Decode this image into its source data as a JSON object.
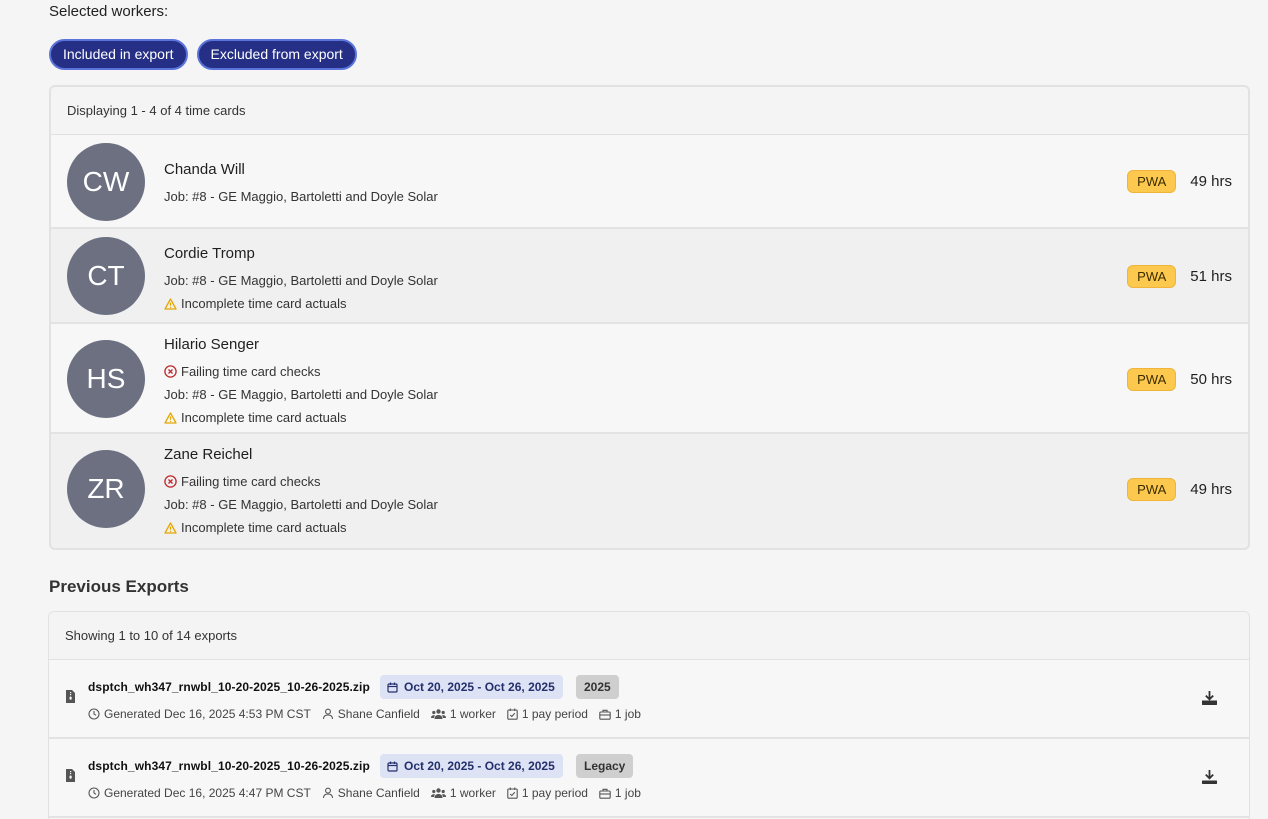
{
  "selected": {
    "title": "Selected workers:",
    "included_label": "Included in export",
    "excluded_label": "Excluded from export"
  },
  "timecards": {
    "summary": "Displaying 1 - 4 of 4 time cards",
    "workers": [
      {
        "initials": "CW",
        "name": "Chanda Will",
        "job": "Job: #8 - GE Maggio, Bartoletti and Doyle Solar",
        "failing": "",
        "incomplete": "",
        "badge": "PWA",
        "hours": "49 hrs"
      },
      {
        "initials": "CT",
        "name": "Cordie Tromp",
        "job": "Job: #8 - GE Maggio, Bartoletti and Doyle Solar",
        "failing": "",
        "incomplete": "Incomplete time card actuals",
        "badge": "PWA",
        "hours": "51 hrs"
      },
      {
        "initials": "HS",
        "name": "Hilario Senger",
        "job": "Job: #8 - GE Maggio, Bartoletti and Doyle Solar",
        "failing": "Failing time card checks",
        "incomplete": "Incomplete time card actuals",
        "badge": "PWA",
        "hours": "50 hrs"
      },
      {
        "initials": "ZR",
        "name": "Zane Reichel",
        "job": "Job: #8 - GE Maggio, Bartoletti and Doyle Solar",
        "failing": "Failing time card checks",
        "incomplete": "Incomplete time card actuals",
        "badge": "PWA",
        "hours": "49 hrs"
      }
    ]
  },
  "previous_exports": {
    "title": "Previous Exports",
    "summary": "Showing 1 to 10 of 14 exports",
    "items": [
      {
        "filename": "dsptch_wh347_rnwbl_10-20-2025_10-26-2025.zip",
        "date_range": "Oct 20, 2025 - Oct 26, 2025",
        "tag": "2025",
        "generated": "Generated Dec 16, 2025 4:53 PM CST",
        "user": "Shane Canfield",
        "workers": "1 worker",
        "pay_periods": "1 pay period",
        "jobs": "1 job"
      },
      {
        "filename": "dsptch_wh347_rnwbl_10-20-2025_10-26-2025.zip",
        "date_range": "Oct 20, 2025 - Oct 26, 2025",
        "tag": "Legacy",
        "generated": "Generated Dec 16, 2025 4:47 PM CST",
        "user": "Shane Canfield",
        "workers": "1 worker",
        "pay_periods": "1 pay period",
        "jobs": "1 job"
      }
    ]
  },
  "colors": {
    "pill_bg": "#262f86",
    "pwa_badge": "#fcc84e",
    "avatar": "#6c7081",
    "warning": "#e6a700",
    "error": "#c0282d",
    "date_chip": "#dde2f5"
  }
}
